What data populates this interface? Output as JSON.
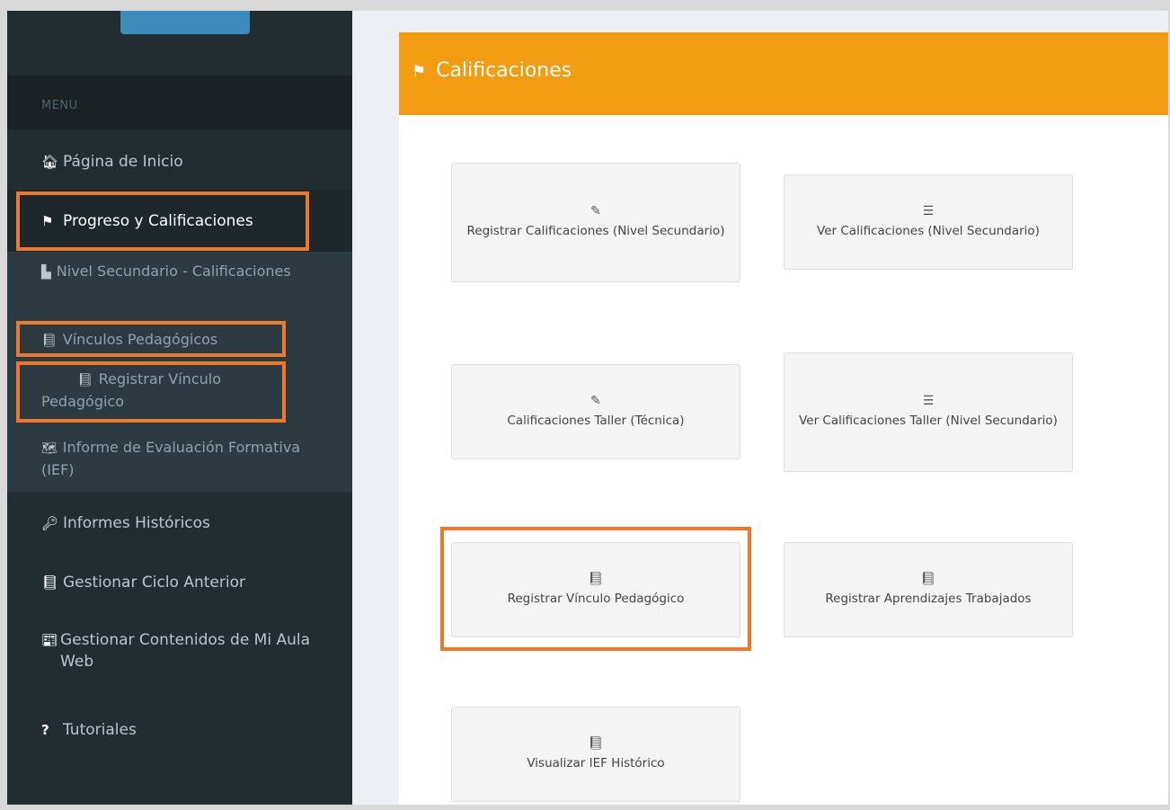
{
  "sidebar": {
    "menu_header": "MENU",
    "items": [
      {
        "label": "Página de Inicio",
        "icon": "home-icon",
        "glyph": "🏠︎"
      },
      {
        "label": "Progreso y Calificaciones",
        "icon": "flag-icon",
        "glyph": "⚑"
      },
      {
        "label": "Informes Históricos",
        "icon": "key-icon",
        "glyph": "🔑︎"
      },
      {
        "label": "Gestionar Ciclo Anterior",
        "icon": "book-icon",
        "glyph": "📘︎"
      },
      {
        "label": "Gestionar Contenidos de Mi Aula Web",
        "icon": "newspaper-icon",
        "glyph": "📰︎"
      },
      {
        "label": "Tutoriales",
        "icon": "question-icon",
        "glyph": "?"
      }
    ],
    "sub_items": [
      {
        "label": "Nivel Secundario - Calificaciones",
        "icon": "copy-icon",
        "glyph": "▙"
      },
      {
        "label": "Vínculos Pedagógicos",
        "icon": "book-icon",
        "glyph": "📘︎"
      },
      {
        "label": "Registrar Vínculo Pedagógico",
        "icon": "book-icon",
        "glyph": "📘︎"
      },
      {
        "label": "Informe de Evaluación Formativa (IEF)",
        "icon": "map-icon",
        "glyph": "🗺︎"
      }
    ]
  },
  "panel": {
    "title": "Calificaciones",
    "title_icon": "flag-icon",
    "title_glyph": "⚑",
    "tiles": [
      {
        "label": "Registrar Calificaciones (Nivel Secundario)",
        "icon": "edit-icon",
        "glyph": "✎"
      },
      {
        "label": "Ver Calificaciones (Nivel Secundario)",
        "icon": "list-icon",
        "glyph": "☰"
      },
      {
        "label": "Calificaciones Taller (Técnica)",
        "icon": "edit-icon",
        "glyph": "✎"
      },
      {
        "label": "Ver Calificaciones Taller (Nivel Secundario)",
        "icon": "list-icon",
        "glyph": "☰"
      },
      {
        "label": "Registrar Vínculo Pedagógico",
        "icon": "book-icon",
        "glyph": "📘︎"
      },
      {
        "label": "Registrar Aprendizajes Trabajados",
        "icon": "book-icon",
        "glyph": "📘︎"
      },
      {
        "label": "Visualizar IEF Histórico",
        "icon": "book-icon",
        "glyph": "📘︎"
      }
    ]
  },
  "colors": {
    "sidebar_bg": "#222d32",
    "header_orange": "#f39c12",
    "highlight_orange": "#ec7a2d"
  }
}
